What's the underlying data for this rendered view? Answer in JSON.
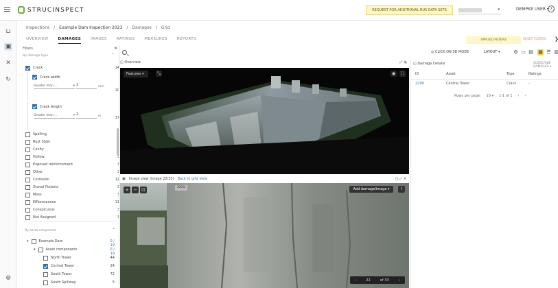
{
  "app": {
    "logo_text": "STRUCINSPECT"
  },
  "header": {
    "request_button": "REQUEST FOR ADDITIONAL RUS DATA SETS",
    "user_label": "DEMPKE USER",
    "help_symbol": "?"
  },
  "breadcrumb": {
    "root": "Inspections",
    "project": "Example Dam Inspection 2023",
    "section": "Damages",
    "sub": "Grid",
    "separator": "/"
  },
  "tabs": [
    "OVERVIEW",
    "DAMAGES",
    "IMAGES",
    "RATINGS",
    "MEASURES",
    "REPORTS"
  ],
  "active_tab": "DAMAGES",
  "filter_actions": {
    "applied": "APPLIED FILTERS",
    "reset": "RESET FILTERS"
  },
  "filters": {
    "title": "Filters",
    "section_label": "By damage type",
    "crack": {
      "label": "Crack",
      "count": "14"
    },
    "crack_width": {
      "label": "Crack width",
      "operator": "Greater than ...",
      "value": "1",
      "unit": "mm",
      "count": "10"
    },
    "crack_length": {
      "label": "Crack length",
      "operator": "Greater than ...",
      "value": "2",
      "unit": "m",
      "count": "17"
    },
    "types": [
      {
        "label": "Spalling",
        "count": "8"
      },
      {
        "label": "Rust Stain",
        "count": "3"
      },
      {
        "label": "Cavity",
        "count": "3"
      },
      {
        "label": "Hollow",
        "count": "3"
      },
      {
        "label": "Exposed reinforcement",
        "count": "3"
      },
      {
        "label": "Other",
        "count": "3"
      },
      {
        "label": "Corrosion",
        "count": "12"
      },
      {
        "label": "Gravel Pockets",
        "count": "3"
      },
      {
        "label": "Moss",
        "count": "3"
      },
      {
        "label": "Efflorescence",
        "count": "11"
      },
      {
        "label": "Conspicuous",
        "count": "3"
      },
      {
        "label": "Not Assigned",
        "count": "3"
      }
    ],
    "group_label": "By asset component",
    "tree": [
      {
        "label": "Example Dam",
        "count": "0 / 19"
      },
      {
        "label": "Asset components",
        "count": "0 / 19"
      },
      {
        "label": "North Tower",
        "count": "44"
      },
      {
        "label": "Central Tower",
        "count": "24"
      },
      {
        "label": "South Tower",
        "count": "72"
      },
      {
        "label": "South Spillway",
        "count": "5"
      }
    ]
  },
  "toolbar": {
    "click3d": "CLICK ON 3D MODE",
    "layout": "LAYOUT"
  },
  "overview": {
    "title": "Overview",
    "features_btn": "Features"
  },
  "image_view": {
    "title": "Image view (image 22/33)",
    "back_link": "Back to grid view",
    "zoom": "100%",
    "add_damage": "Add damage/image",
    "pager_current": "22",
    "pager_total": "of 33"
  },
  "damage_details": {
    "title": "Damage Details",
    "more": "SUBSCRIBE DAMAGES",
    "columns": [
      "ID",
      "Asset",
      "Type",
      "Ratings"
    ],
    "row": {
      "id": "2299",
      "asset": "Central Tower",
      "type": "Crack",
      "rating": "-"
    },
    "pager": {
      "label": "Rows per page:",
      "value": "10",
      "range": "1-1 of 1"
    }
  },
  "colors": {
    "accent": "#2f6fb3",
    "brand_green": "#6aab3e",
    "highlight": "#f6de44"
  }
}
